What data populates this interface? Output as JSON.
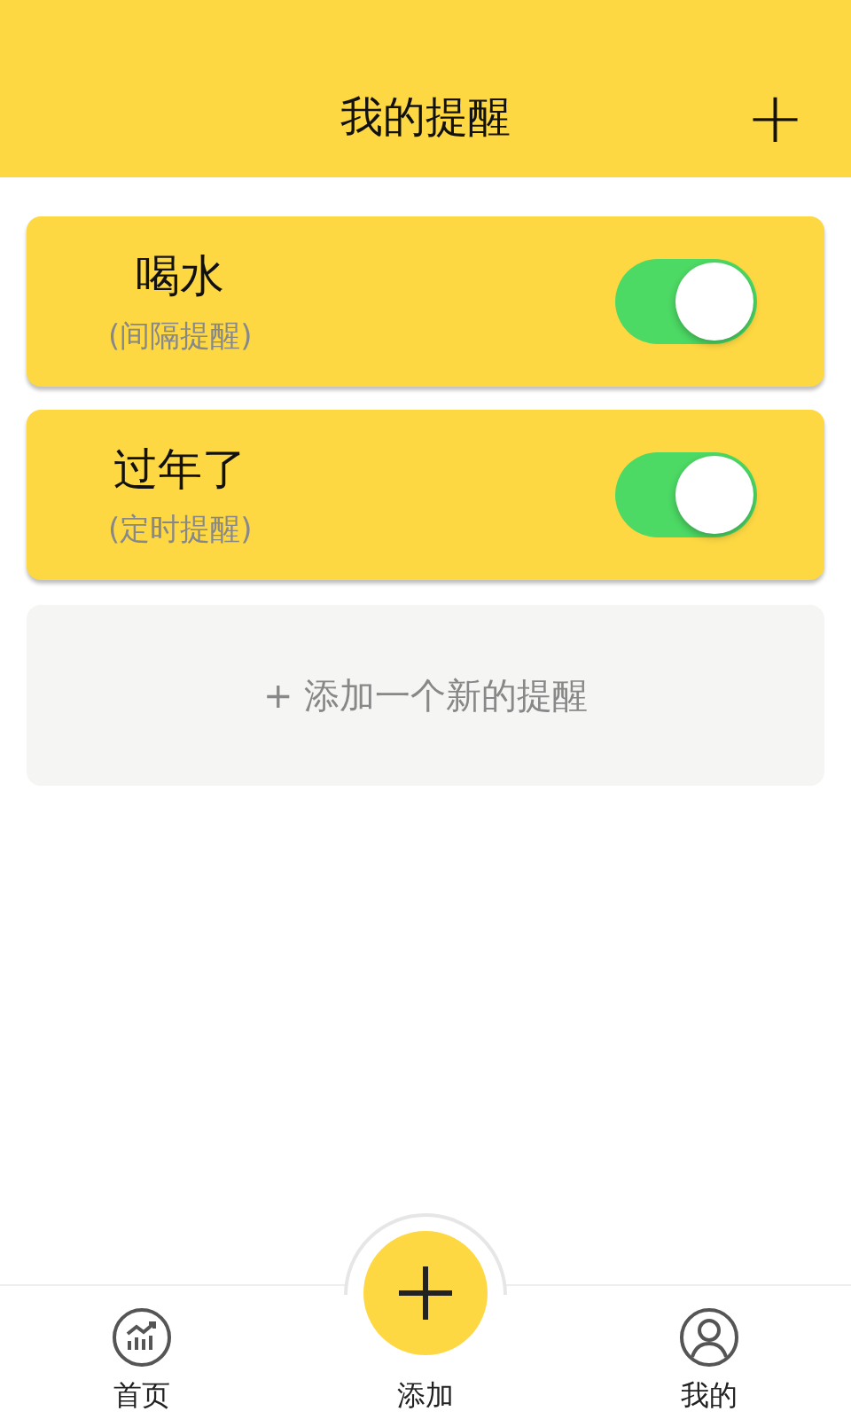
{
  "header": {
    "title": "我的提醒",
    "action": "+"
  },
  "reminders": [
    {
      "title": "喝水",
      "type": "(间隔提醒)",
      "on": true
    },
    {
      "title": "过年了",
      "type": "(定时提醒)",
      "on": true
    }
  ],
  "add_new": "+ 添加一个新的提醒",
  "tab_bar": [
    {
      "kind": "home",
      "label": "首页"
    },
    {
      "kind": "add",
      "label": "添加"
    },
    {
      "kind": "me",
      "label": "我的"
    }
  ]
}
